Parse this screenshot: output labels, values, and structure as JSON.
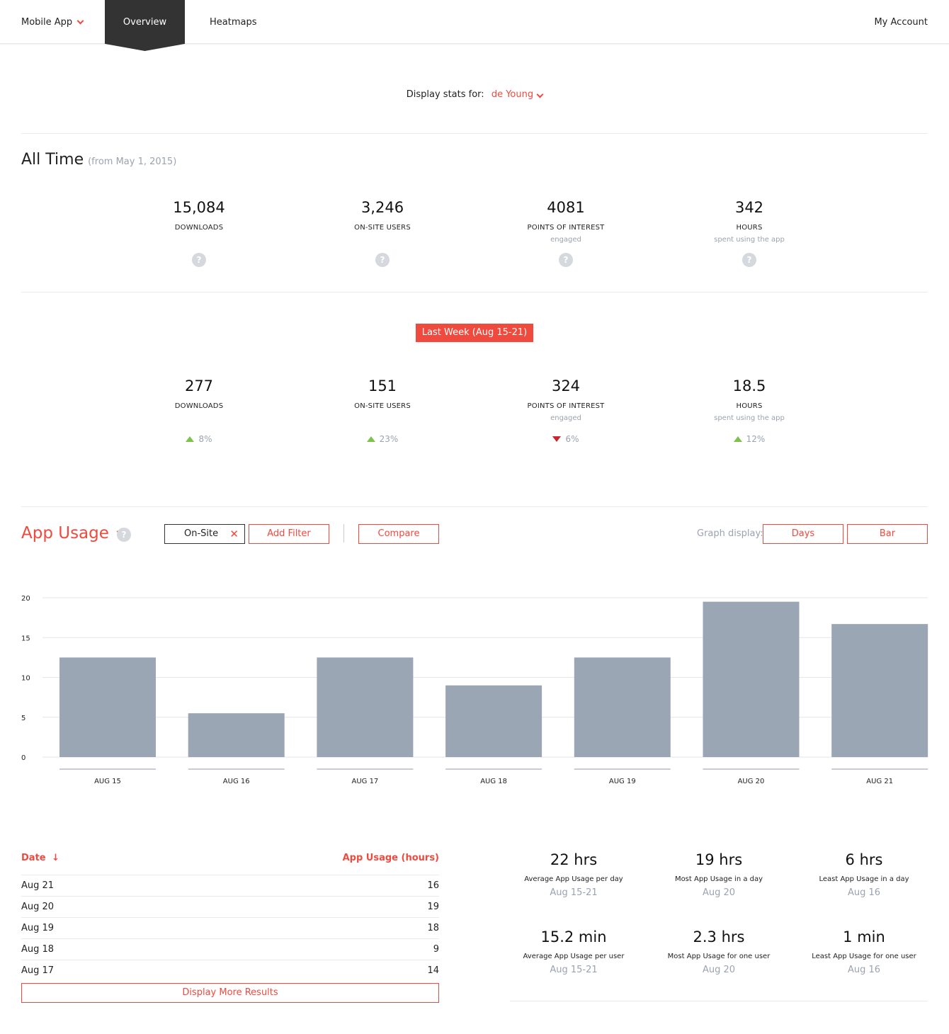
{
  "nav": {
    "app_label": "Mobile App",
    "tab_overview": "Overview",
    "tab_heatmaps": "Heatmaps",
    "account": "My Account"
  },
  "display_stats": {
    "label": "Display stats for:",
    "value": "de Young"
  },
  "all_time": {
    "title": "All Time",
    "subtitle": "(from May 1, 2015)",
    "stats": [
      {
        "value": "15,084",
        "label": "DOWNLOADS",
        "sub": ""
      },
      {
        "value": "3,246",
        "label": "ON-SITE USERS",
        "sub": ""
      },
      {
        "value": "4081",
        "label": "POINTS OF INTEREST",
        "sub": "engaged"
      },
      {
        "value": "342",
        "label": "HOURS",
        "sub": "spent using the app"
      }
    ],
    "help_icon": "?"
  },
  "last_week": {
    "badge": "Last Week (Aug 15-21)",
    "stats": [
      {
        "value": "277",
        "label": "DOWNLOADS",
        "sub": "",
        "change": "8%",
        "direction": "up"
      },
      {
        "value": "151",
        "label": "ON-SITE USERS",
        "sub": "",
        "change": "23%",
        "direction": "up"
      },
      {
        "value": "324",
        "label": "POINTS OF INTEREST",
        "sub": "engaged",
        "change": "6%",
        "direction": "down"
      },
      {
        "value": "18.5",
        "label": "HOURS",
        "sub": "spent using the app",
        "change": "12%",
        "direction": "up"
      }
    ]
  },
  "app_usage": {
    "title": "App Usage",
    "filter_chip": "On-Site",
    "filter_remove": "✕",
    "add_filter": "Add Filter",
    "compare": "Compare",
    "graph_display_label": "Graph display:",
    "graph_days": "Days",
    "graph_bar": "Bar"
  },
  "colors": {
    "accent": "#f04a3e",
    "bar": "#9ba6b5",
    "up": "#7dc24b",
    "down": "#c9252c"
  },
  "chart_data": {
    "type": "bar",
    "categories": [
      "AUG 15",
      "AUG 16",
      "AUG 17",
      "AUG 18",
      "AUG 19",
      "AUG 20",
      "AUG 21"
    ],
    "values": [
      12.5,
      5.5,
      12.5,
      9,
      12.5,
      19.5,
      16.7
    ],
    "yticks": [
      0,
      5,
      10,
      15,
      20
    ],
    "ylim": [
      0,
      20
    ],
    "grid": true
  },
  "table": {
    "col_date": "Date",
    "col_usage": "App Usage (hours)",
    "rows": [
      {
        "date": "Aug 21",
        "value": "16"
      },
      {
        "date": "Aug 20",
        "value": "19"
      },
      {
        "date": "Aug 19",
        "value": "18"
      },
      {
        "date": "Aug 18",
        "value": "9"
      },
      {
        "date": "Aug 17",
        "value": "14"
      }
    ],
    "more": "Display More Results"
  },
  "summary": [
    {
      "big": "22 hrs",
      "desc": "Average App Usage per day",
      "date": "Aug 15-21"
    },
    {
      "big": "19 hrs",
      "desc": "Most App Usage in a day",
      "date": "Aug 20"
    },
    {
      "big": "6 hrs",
      "desc": "Least App Usage in a day",
      "date": "Aug 16"
    },
    {
      "big": "15.2 min",
      "desc": "Average App Usage per user",
      "date": "Aug 15-21"
    },
    {
      "big": "2.3 hrs",
      "desc": "Most App Usage for one user",
      "date": "Aug 20"
    },
    {
      "big": "1 min",
      "desc": "Least App Usage for one user",
      "date": "Aug 16"
    }
  ]
}
